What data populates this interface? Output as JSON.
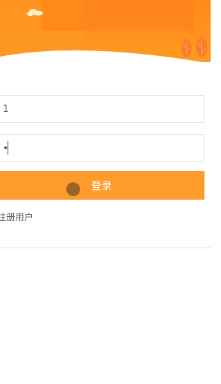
{
  "login_form": {
    "username_value": "1",
    "password_mask": "•",
    "login_label": "登录",
    "register_label": "注册用户"
  },
  "colors": {
    "header_orange": "#ff8f1f",
    "button_orange": "#ff9b2b",
    "tree_orange": "#ff7a20"
  }
}
